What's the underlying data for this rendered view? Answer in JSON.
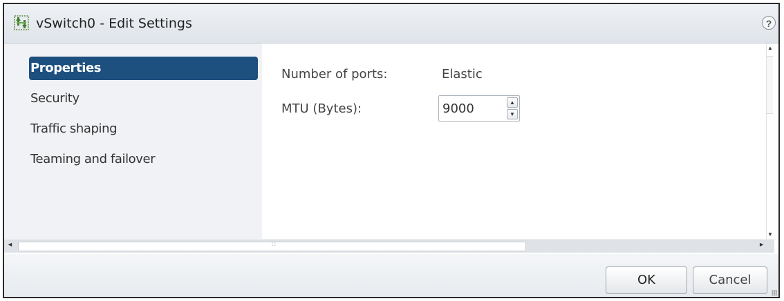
{
  "window": {
    "title": "vSwitch0 - Edit Settings",
    "icon": "vswitch-icon",
    "help_label": "?"
  },
  "nav": {
    "items": [
      {
        "label": "Properties",
        "active": true
      },
      {
        "label": "Security",
        "active": false
      },
      {
        "label": "Traffic shaping",
        "active": false
      },
      {
        "label": "Teaming and failover",
        "active": false
      }
    ]
  },
  "properties": {
    "ports_label": "Number of ports:",
    "ports_value": "Elastic",
    "mtu_label": "MTU (Bytes):",
    "mtu_value": "9000"
  },
  "footer": {
    "ok_label": "OK",
    "cancel_label": "Cancel"
  },
  "colors": {
    "nav_active_bg": "#1d4f7f",
    "nav_bg": "#f0f2f5"
  }
}
